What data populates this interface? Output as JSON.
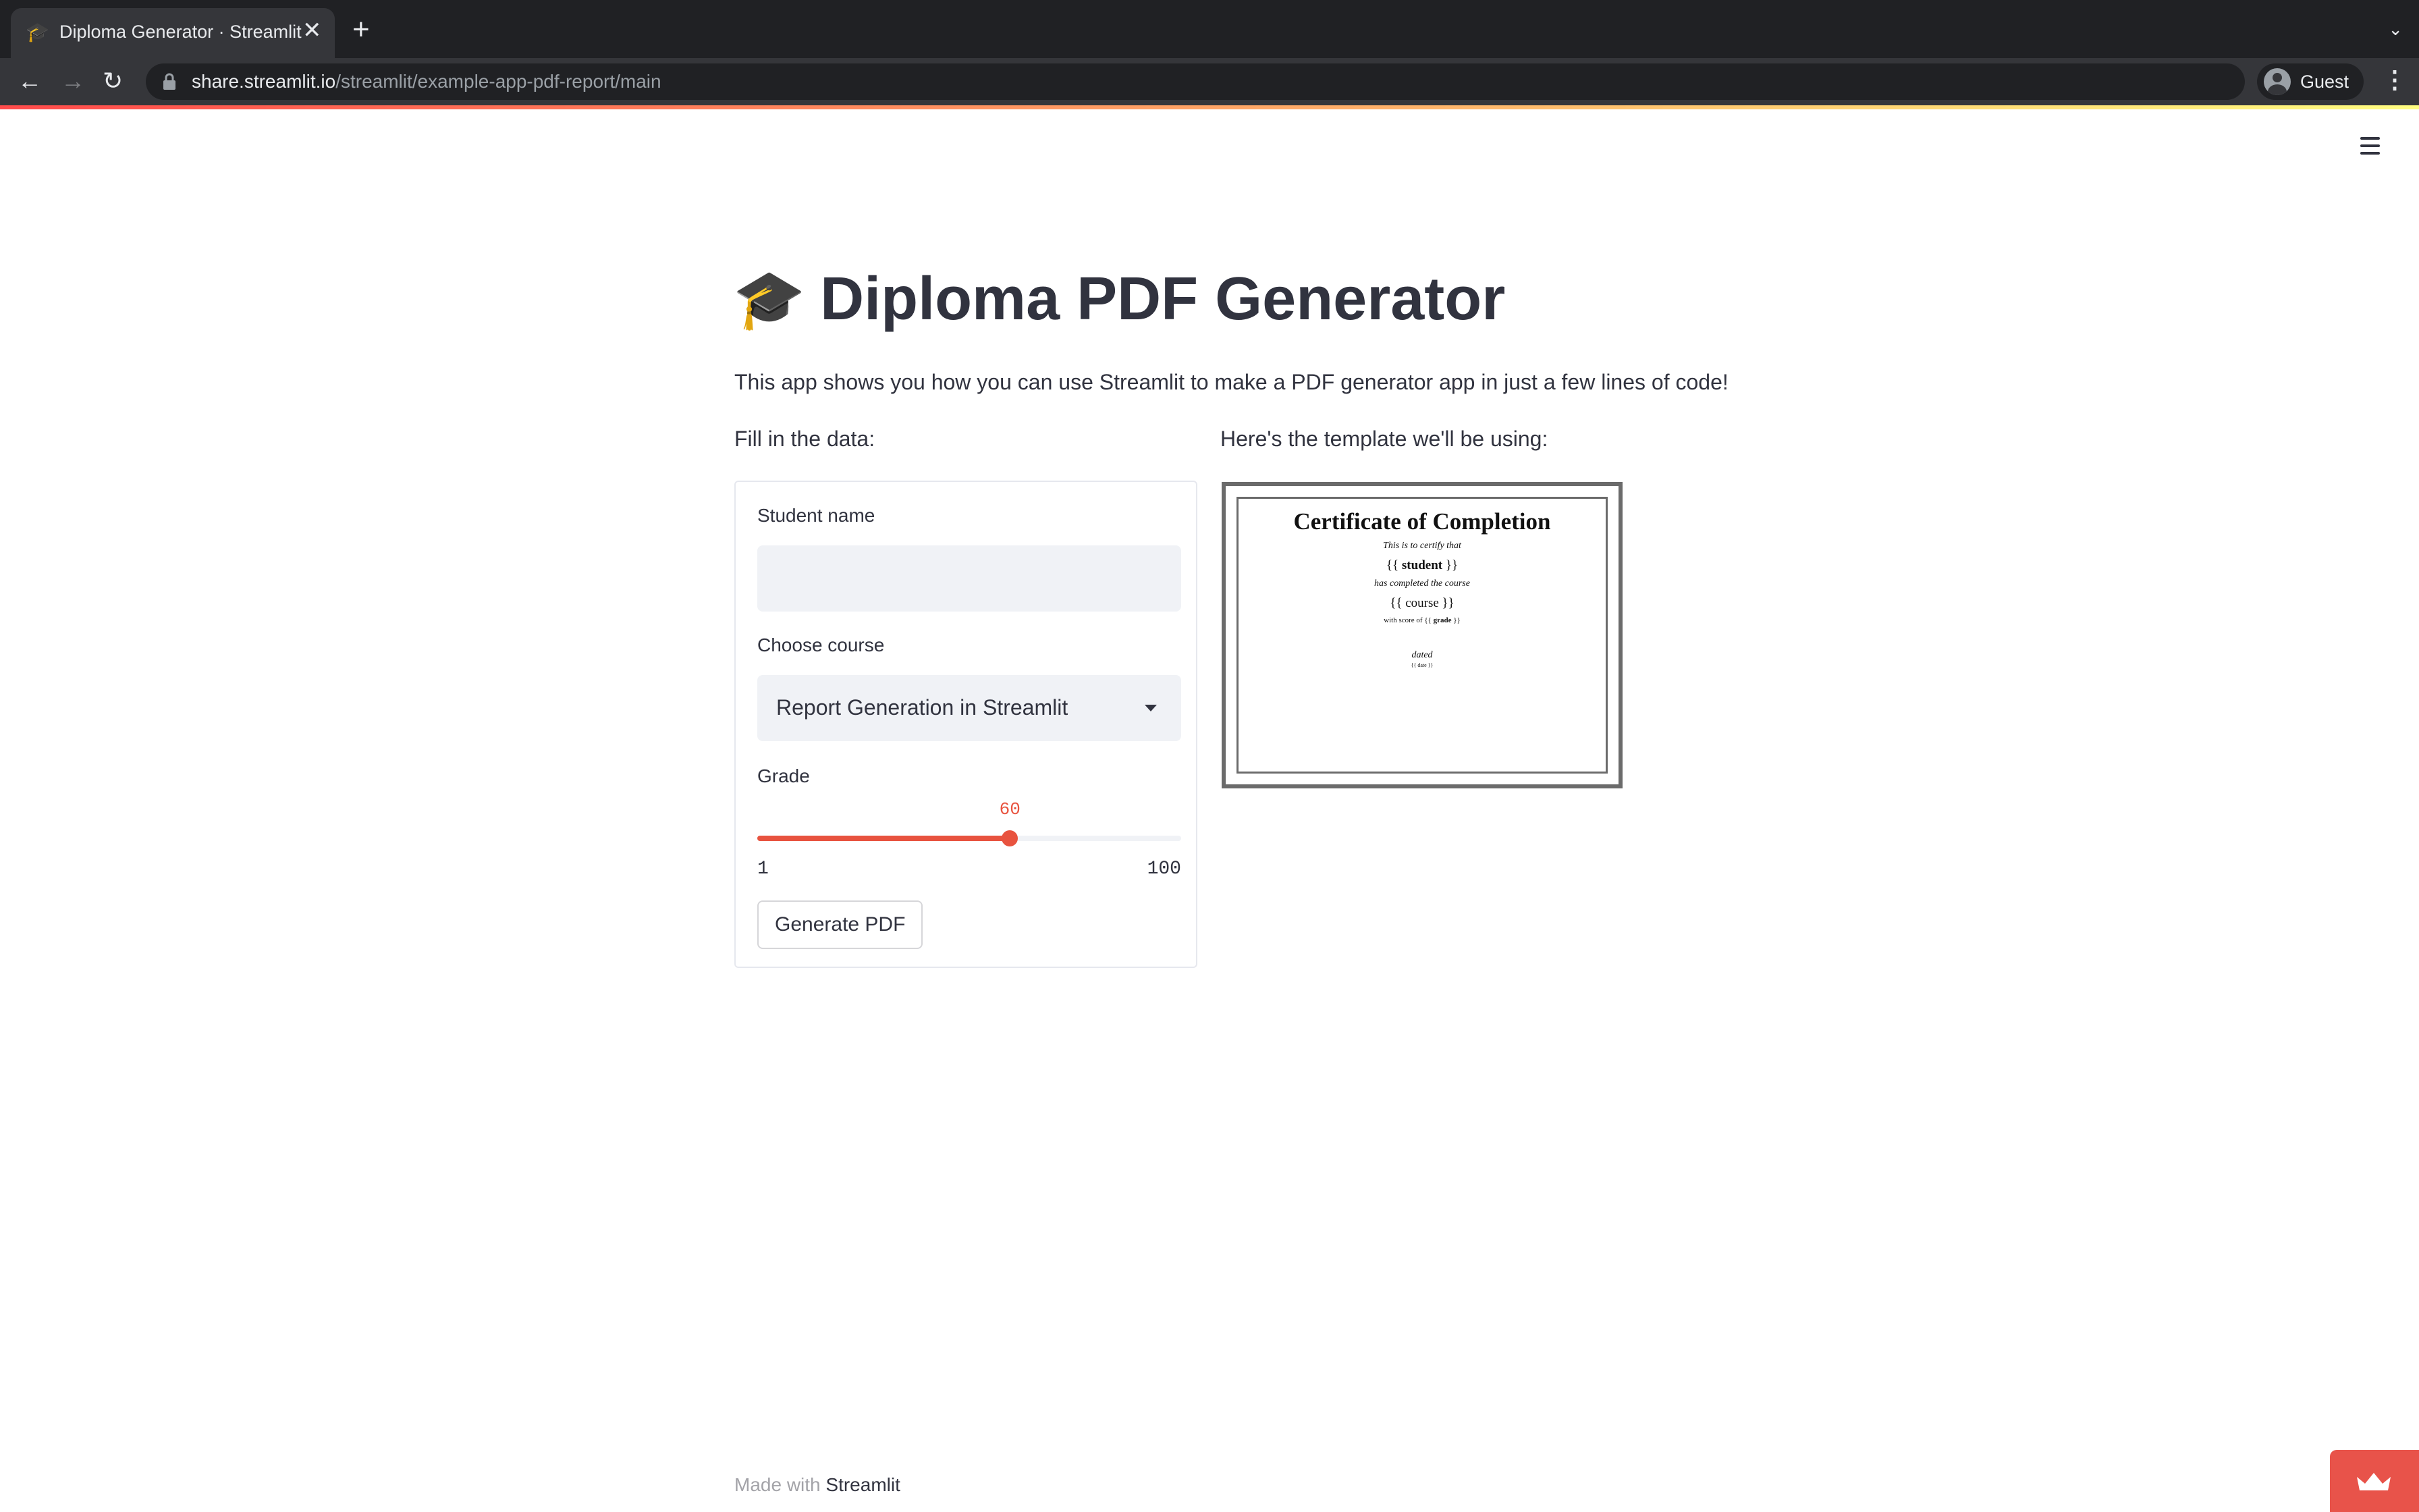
{
  "browser": {
    "tab": {
      "favicon": "🎓",
      "title": "Diploma Generator · Streamlit",
      "close": "✕"
    },
    "new_tab": "+",
    "tab_dropdown": "⌄",
    "nav": {
      "back": "←",
      "forward": "→",
      "reload": "↻"
    },
    "address": {
      "host": "share.streamlit.io",
      "path": "/streamlit/example-app-pdf-report/main"
    },
    "profile_label": "Guest",
    "menu": "⋮"
  },
  "app": {
    "title_emoji": "🎓",
    "title": "Diploma PDF Generator",
    "intro": "This app shows you how you can use Streamlit to make a PDF generator app in just a few lines of code!",
    "left_column_label": "Fill in the data:",
    "right_column_label": "Here's the template we'll be using:",
    "form": {
      "student_label": "Student name",
      "student_value": "",
      "course_label": "Choose course",
      "course_value": "Report Generation in Streamlit",
      "grade_label": "Grade",
      "grade_value": 60,
      "grade_value_text": "60",
      "grade_min": "1",
      "grade_max": "100",
      "button_label": "Generate PDF"
    },
    "template": {
      "title": "Certificate of Completion",
      "line1": "This is to certify that",
      "student_var_open": "{{ ",
      "student_var": "student",
      "student_var_close": " }}",
      "line2": "has completed the course",
      "course_var": "{{ course }}",
      "score_prefix": "with score of ",
      "grade_var_open": "{{ ",
      "grade_var": "grade",
      "grade_var_close": " }}",
      "dated": "dated",
      "date_var": "{{ date }}"
    },
    "footer": {
      "prefix": "Made with ",
      "brand": "Streamlit"
    }
  },
  "colors": {
    "primary": "#e8533f",
    "text": "#31333f",
    "input_bg": "#f0f2f6",
    "chrome_dark": "#202124",
    "chrome_toolbar": "#35363a"
  },
  "icons": [
    "lock-icon",
    "hamburger-menu-icon",
    "profile-icon",
    "crown-icon",
    "graduation-cap-icon",
    "chevron-down-icon"
  ]
}
